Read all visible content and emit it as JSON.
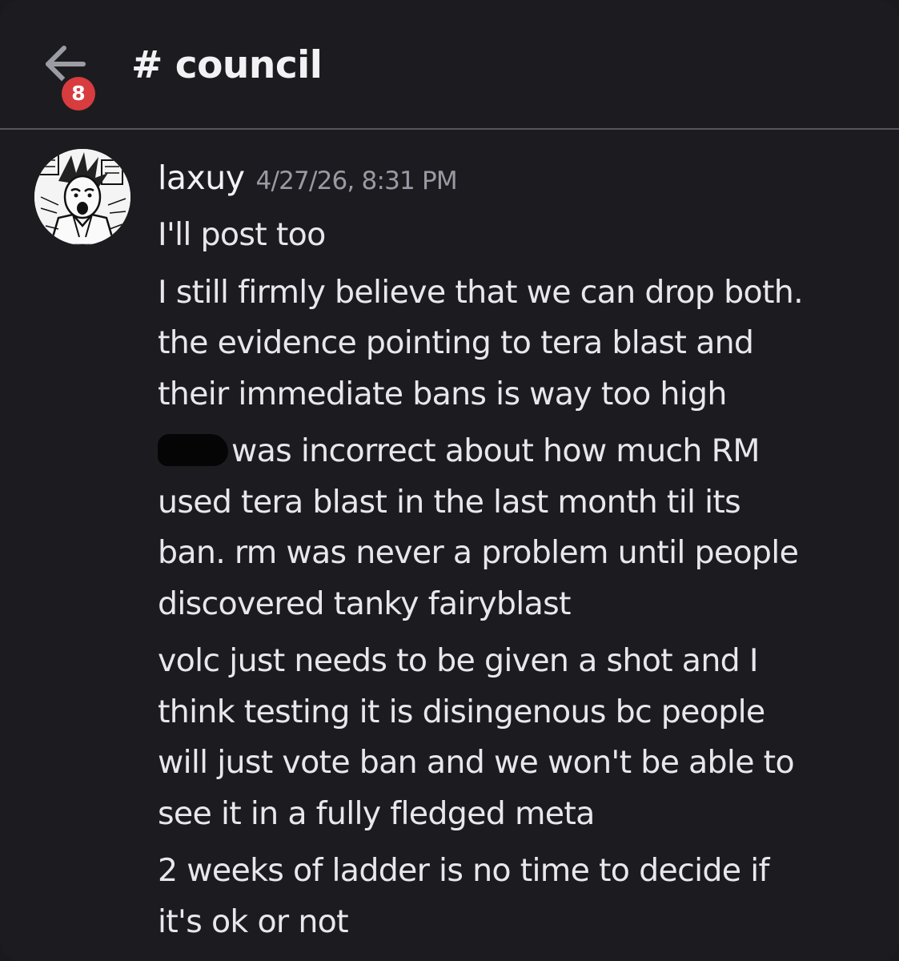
{
  "header": {
    "channel_name": "# council",
    "unread_badge": "8",
    "back_icon": "arrow-left-icon"
  },
  "message": {
    "username": "laxuy",
    "timestamp": "4/27/26, 8:31 PM",
    "avatar": "manga-avatar",
    "blocks": [
      {
        "lines": [
          "I'll post too"
        ]
      },
      {
        "lines": [
          "I still firmly believe that we can drop both.",
          "the evidence pointing to tera blast and",
          "their immediate bans is way too high"
        ]
      },
      {
        "lines": [
          "was incorrect about how much RM",
          "used tera blast in the last month til its",
          "ban. rm was never a problem until people",
          "discovered tanky fairyblast"
        ]
      },
      {
        "lines": [
          "volc just needs to be given a shot and I",
          "think testing it is disingenous bc people",
          "will just vote ban and we won't be able to",
          "see it in a fully fledged meta"
        ]
      },
      {
        "lines": [
          "2 weeks of ladder is no time to decide if",
          "it's ok or not"
        ]
      }
    ]
  },
  "colors": {
    "background": "#1c1c20",
    "badge": "#d83c3e",
    "timestamp": "#9a9aa3",
    "text": "#e8e8ec"
  }
}
